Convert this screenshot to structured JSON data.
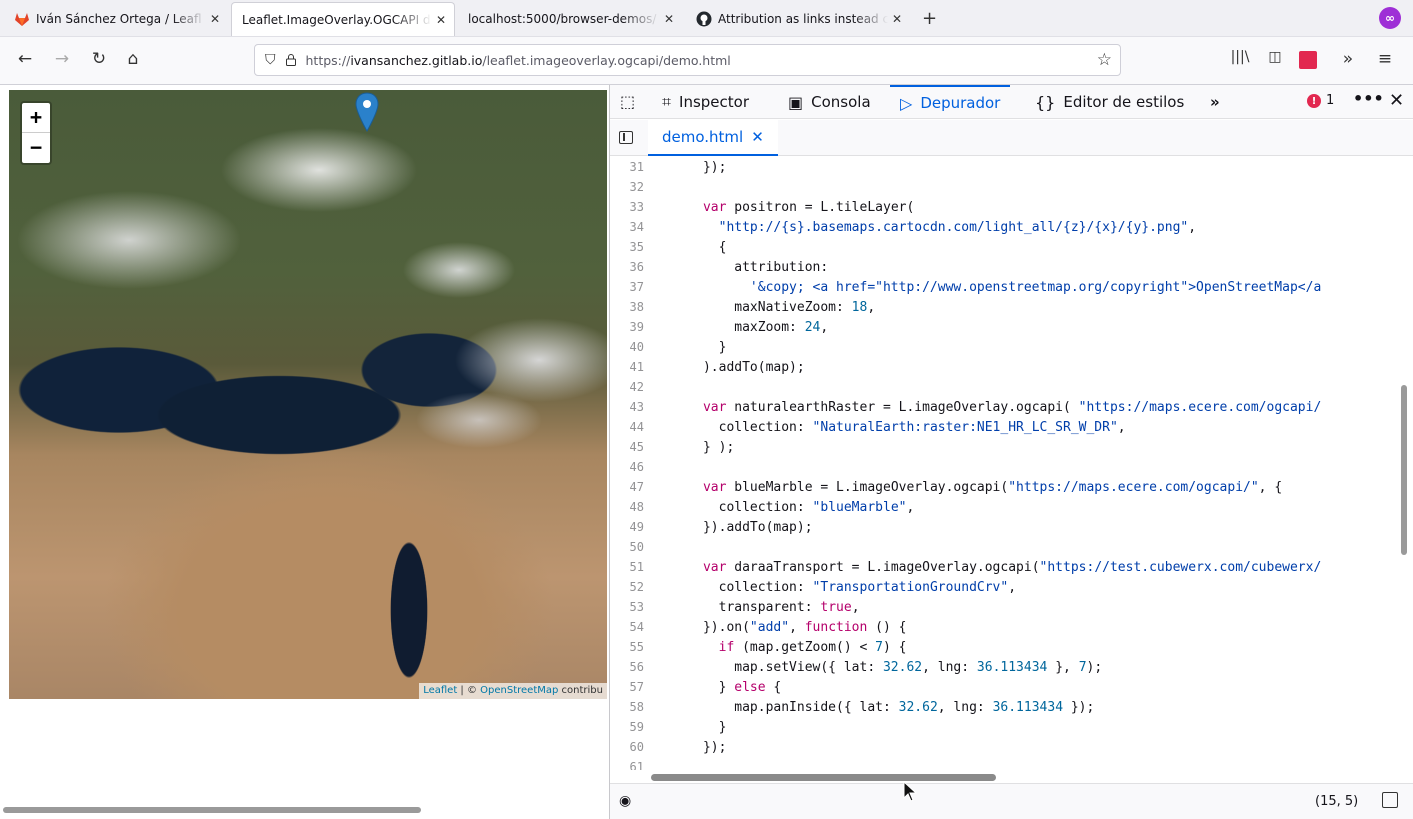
{
  "browser": {
    "tabs": [
      {
        "label": "Iván Sánchez Ortega / Leafl",
        "icon": "gitlab-icon"
      },
      {
        "label": "Leaflet.ImageOverlay.OGCAPI d",
        "icon": ""
      },
      {
        "label": "localhost:5000/browser-demos/",
        "icon": ""
      },
      {
        "label": "Attribution as links instead c",
        "icon": "github-icon"
      }
    ],
    "active_tab": 1,
    "new_tab_label": "+",
    "extension_label": "∞",
    "url_prefix": "https://",
    "url_host": "ivansanchez.gitlab.io",
    "url_path": "/leaflet.imageoverlay.ogcapi/demo.html"
  },
  "map": {
    "zoom_in": "+",
    "zoom_out": "−",
    "attribution_leaflet": "Leaflet",
    "attribution_sep": " | © ",
    "attribution_osm": "OpenStreetMap",
    "attribution_rest": " contribu"
  },
  "devtools": {
    "tabs": [
      {
        "label": "Inspector",
        "icon": "inspector-icon"
      },
      {
        "label": "Consola",
        "icon": "console-icon"
      },
      {
        "label": "Depurador",
        "icon": "debugger-icon"
      },
      {
        "label": "Editor de estilos",
        "icon": "style-editor-icon"
      }
    ],
    "selected_tab": 2,
    "error_count": "1",
    "source_tab": "demo.html",
    "cursor_position": "(15, 5)",
    "accent": "#0060df",
    "code": [
      {
        "n": "31",
        "t": "      });"
      },
      {
        "n": "32",
        "t": ""
      },
      {
        "n": "33",
        "t": "      var positron = L.tileLayer("
      },
      {
        "n": "34",
        "t": "        \"http://{s}.basemaps.cartocdn.com/light_all/{z}/{x}/{y}.png\","
      },
      {
        "n": "35",
        "t": "        {"
      },
      {
        "n": "36",
        "t": "          attribution:"
      },
      {
        "n": "37",
        "t": "            '&copy; <a href=\"http://www.openstreetmap.org/copyright\">OpenStreetMap</a"
      },
      {
        "n": "38",
        "t": "          maxNativeZoom: 18,"
      },
      {
        "n": "39",
        "t": "          maxZoom: 24,"
      },
      {
        "n": "40",
        "t": "        }"
      },
      {
        "n": "41",
        "t": "      ).addTo(map);"
      },
      {
        "n": "42",
        "t": ""
      },
      {
        "n": "43",
        "t": "      var naturalearthRaster = L.imageOverlay.ogcapi( \"https://maps.ecere.com/ogcapi/"
      },
      {
        "n": "44",
        "t": "        collection: \"NaturalEarth:raster:NE1_HR_LC_SR_W_DR\","
      },
      {
        "n": "45",
        "t": "      } );"
      },
      {
        "n": "46",
        "t": ""
      },
      {
        "n": "47",
        "t": "      var blueMarble = L.imageOverlay.ogcapi(\"https://maps.ecere.com/ogcapi/\", {"
      },
      {
        "n": "48",
        "t": "        collection: \"blueMarble\","
      },
      {
        "n": "49",
        "t": "      }).addTo(map);"
      },
      {
        "n": "50",
        "t": ""
      },
      {
        "n": "51",
        "t": "      var daraaTransport = L.imageOverlay.ogcapi(\"https://test.cubewerx.com/cubewerx/"
      },
      {
        "n": "52",
        "t": "        collection: \"TransportationGroundCrv\","
      },
      {
        "n": "53",
        "t": "        transparent: true,"
      },
      {
        "n": "54",
        "t": "      }).on(\"add\", function () {"
      },
      {
        "n": "55",
        "t": "        if (map.getZoom() < 7) {"
      },
      {
        "n": "56",
        "t": "          map.setView({ lat: 32.62, lng: 36.113434 }, 7);"
      },
      {
        "n": "57",
        "t": "        } else {"
      },
      {
        "n": "58",
        "t": "          map.panInside({ lat: 32.62, lng: 36.113434 });"
      },
      {
        "n": "59",
        "t": "        }"
      },
      {
        "n": "60",
        "t": "      });"
      },
      {
        "n": "61",
        "t": ""
      }
    ]
  }
}
